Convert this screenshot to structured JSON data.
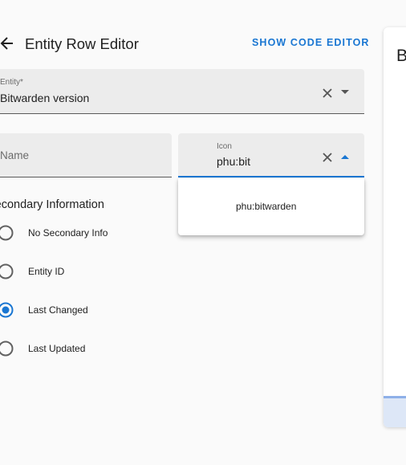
{
  "header": {
    "title": "Entity Row Editor",
    "code_editor_label": "SHOW CODE EDITOR"
  },
  "entity_field": {
    "label": "Entity*",
    "value": "Bitwarden version"
  },
  "name_field": {
    "label": "Name",
    "value": ""
  },
  "icon_field": {
    "label": "Icon",
    "value": "phu:bit"
  },
  "icon_suggestions": [
    {
      "label": "phu:bitwarden"
    }
  ],
  "secondary_info": {
    "title": "Secondary Information",
    "options": [
      {
        "label": "No Secondary Info",
        "selected": false
      },
      {
        "label": "Entity ID",
        "selected": false
      },
      {
        "label": "Last Changed",
        "selected": true
      },
      {
        "label": "Last Updated",
        "selected": false
      }
    ]
  },
  "preview": {
    "title_initial": "B"
  },
  "colors": {
    "accent": "#1976d2",
    "field_bg": "#ececec",
    "page_bg": "#fafafa"
  }
}
